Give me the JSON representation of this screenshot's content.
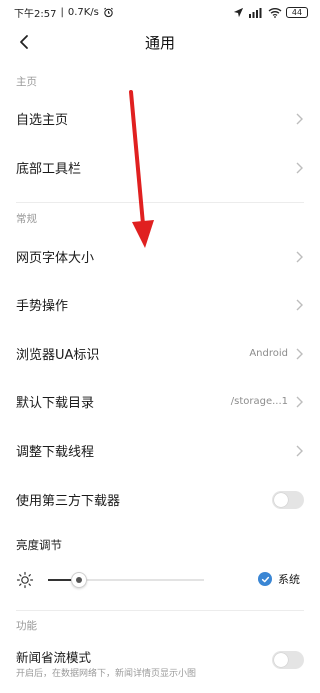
{
  "status_bar": {
    "time": "下午2:57",
    "speed": "0.7K/s",
    "battery": "44"
  },
  "header": {
    "title": "通用"
  },
  "sections": {
    "home": {
      "label": "主页",
      "items": [
        {
          "label": "自选主页"
        },
        {
          "label": "底部工具栏"
        }
      ]
    },
    "general": {
      "label": "常规",
      "items": [
        {
          "label": "网页字体大小",
          "value": ""
        },
        {
          "label": "手势操作",
          "value": ""
        },
        {
          "label": "浏览器UA标识",
          "value": "Android"
        },
        {
          "label": "默认下载目录",
          "value": "/storage...1"
        },
        {
          "label": "调整下载线程",
          "value": ""
        },
        {
          "label": "使用第三方下载器",
          "toggle": false
        }
      ]
    },
    "brightness": {
      "label": "亮度调节",
      "level": 0.2,
      "system_label": "系统",
      "system_checked": true
    },
    "features": {
      "label": "功能",
      "items": [
        {
          "label": "新闻省流模式",
          "sub": "开启后，在数据网络下，新闻详情页显示小图",
          "toggle": false
        }
      ]
    }
  },
  "colors": {
    "accent": "#3a86d4",
    "annotation_arrow": "#e02020"
  }
}
